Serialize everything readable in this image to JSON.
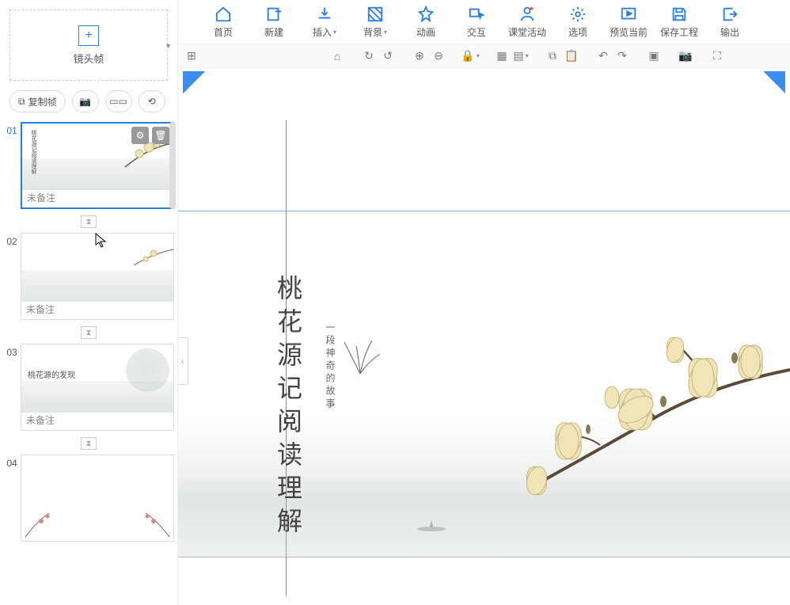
{
  "toolbar": {
    "items": [
      {
        "label": "首页",
        "icon": "home"
      },
      {
        "label": "新建",
        "icon": "new"
      },
      {
        "label": "插入",
        "icon": "insert",
        "dropdown": true
      },
      {
        "label": "背景",
        "icon": "background",
        "dropdown": true
      },
      {
        "label": "动画",
        "icon": "animation"
      },
      {
        "label": "交互",
        "icon": "interaction"
      },
      {
        "label": "课堂活动",
        "icon": "activity"
      },
      {
        "label": "选项",
        "icon": "settings"
      },
      {
        "label": "预览当前",
        "icon": "preview"
      },
      {
        "label": "保存工程",
        "icon": "save"
      },
      {
        "label": "输出",
        "icon": "export"
      }
    ]
  },
  "sidebar": {
    "camera_frame_label": "镜头帧",
    "copy_frame_label": "复制帧"
  },
  "slides": [
    {
      "num": "01",
      "note": "未备注",
      "active": true,
      "title": "桃花源记阅读理解"
    },
    {
      "num": "02",
      "note": "未备注"
    },
    {
      "num": "03",
      "note": "未备注",
      "title": "桃花源的发现"
    },
    {
      "num": "04",
      "note": ""
    }
  ],
  "canvas": {
    "title": "桃花源记阅读理解",
    "subtitle": "一段神奇的故事"
  }
}
